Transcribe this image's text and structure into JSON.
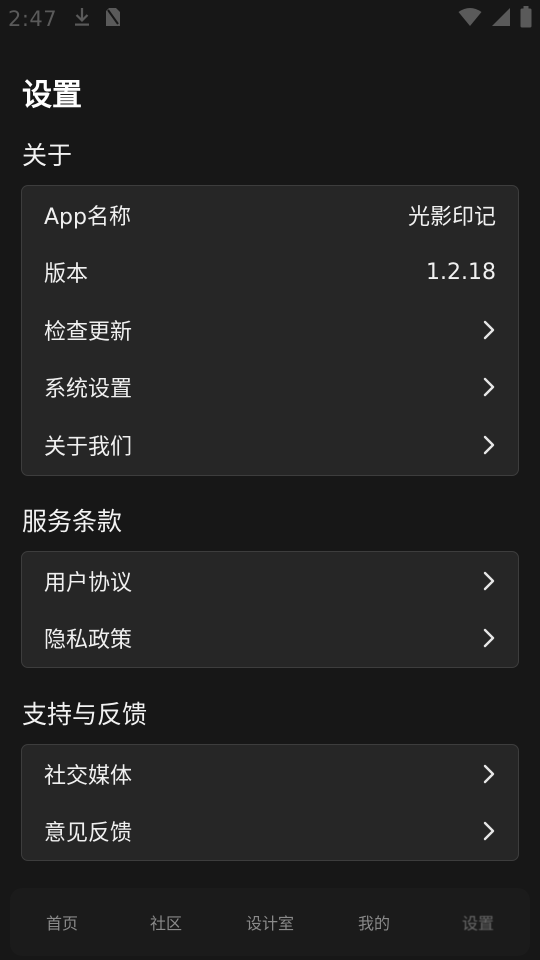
{
  "status_bar": {
    "time": "2:47",
    "icons": [
      "download-icon",
      "no-sim-icon",
      "wifi-icon",
      "signal-icon",
      "battery-icon"
    ]
  },
  "page": {
    "title": "设置"
  },
  "sections": [
    {
      "title": "关于",
      "rows": [
        {
          "label": "App名称",
          "value": "光影印记"
        },
        {
          "label": "版本",
          "value": "1.2.18"
        },
        {
          "label": "检查更新",
          "icon": "chevron-right-icon"
        },
        {
          "label": "系统设置",
          "icon": "chevron-right-icon"
        },
        {
          "label": "关于我们",
          "icon": "chevron-right-icon"
        }
      ]
    },
    {
      "title": "服务条款",
      "rows": [
        {
          "label": "用户协议",
          "icon": "chevron-right-icon"
        },
        {
          "label": "隐私政策",
          "icon": "chevron-right-icon"
        }
      ]
    },
    {
      "title": "支持与反馈",
      "rows": [
        {
          "label": "社交媒体",
          "icon": "chevron-right-icon"
        },
        {
          "label": "意见反馈",
          "icon": "chevron-right-icon"
        }
      ]
    }
  ],
  "bottom_nav": {
    "items": [
      {
        "label": "首页"
      },
      {
        "label": "社区"
      },
      {
        "label": "设计室"
      },
      {
        "label": "我的"
      },
      {
        "label": "设置"
      }
    ]
  },
  "colors": {
    "background": "#171717",
    "card": "#262626",
    "card_border": "#3d3d3d",
    "text": "#f0f0f0",
    "nav_text": "#8a8a8a"
  }
}
